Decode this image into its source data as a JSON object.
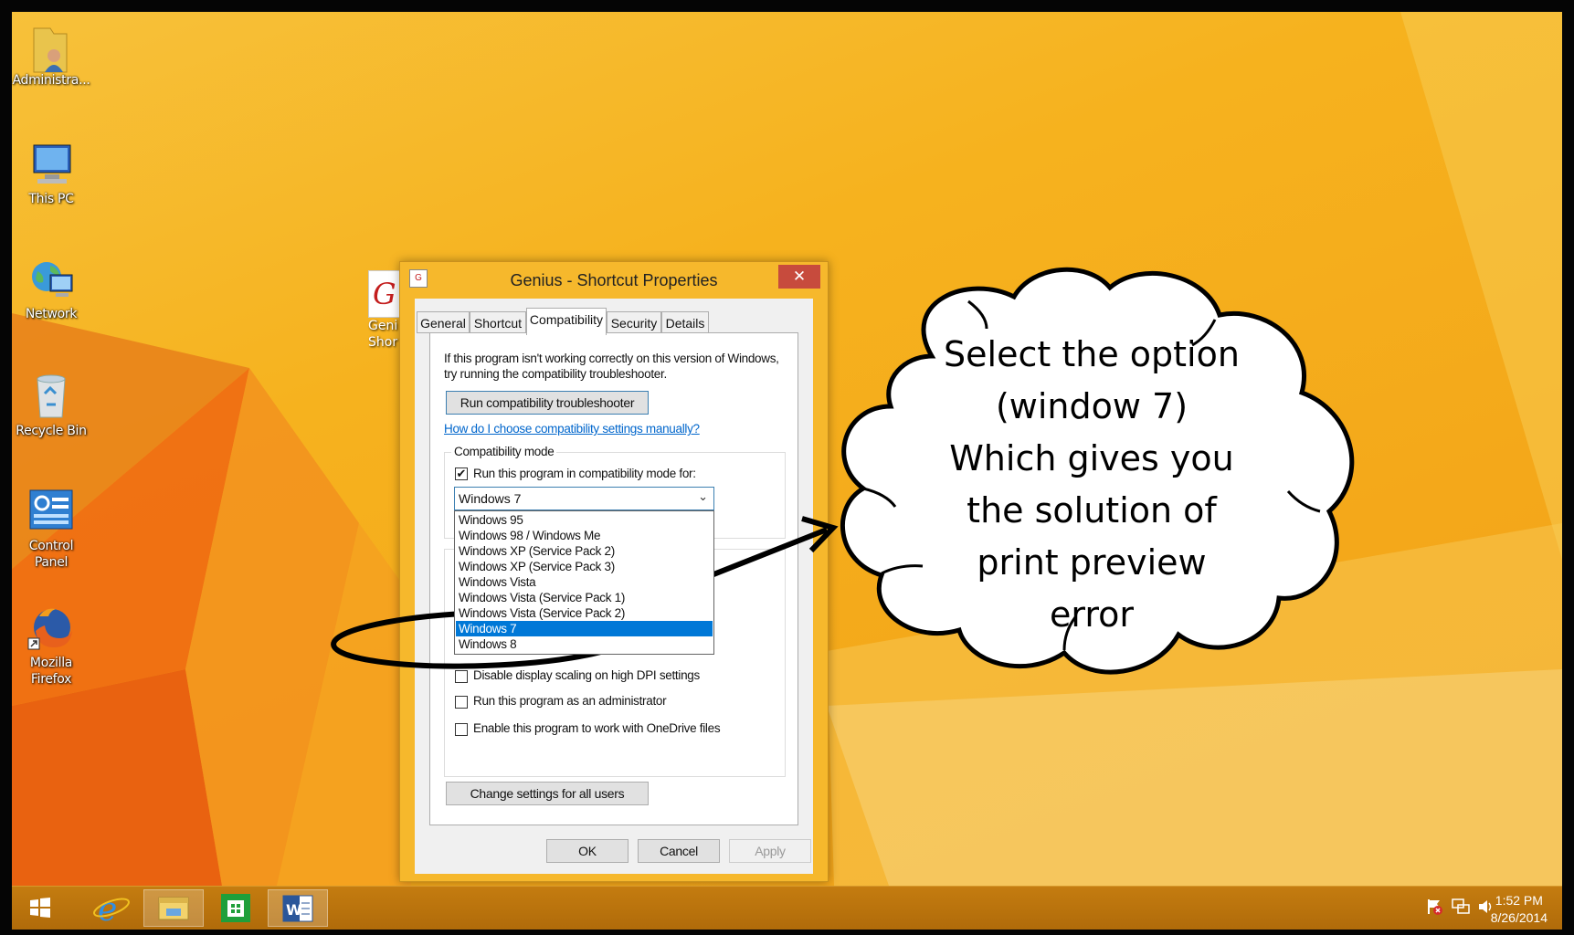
{
  "desktop_icons": [
    {
      "label": "Administra...",
      "icon": "user-folder-icon"
    },
    {
      "label": "This PC",
      "icon": "computer-icon"
    },
    {
      "label": "Network",
      "icon": "network-globe-icon"
    },
    {
      "label": "Recycle Bin",
      "icon": "recycle-bin-icon"
    },
    {
      "label": "Control Panel",
      "icon": "control-panel-icon"
    },
    {
      "label": "Mozilla Firefox",
      "icon": "firefox-icon"
    }
  ],
  "partial_icon": {
    "label_line1": "Geni",
    "label_line2": "Shor"
  },
  "dialog": {
    "title": "Genius - Shortcut Properties",
    "close_label": "✕",
    "tabs": [
      "General",
      "Shortcut",
      "Compatibility",
      "Security",
      "Details"
    ],
    "selected_tab": "Compatibility",
    "intro_line1": "If this program isn't working correctly on this version of Windows,",
    "intro_line2": "try running the compatibility troubleshooter.",
    "troubleshooter_button": "Run compatibility troubleshooter",
    "manual_link": "How do I choose compatibility settings manually?",
    "compat_group_label": "Compatibility mode",
    "compat_checkbox_label": "Run this program in compatibility mode for:",
    "compat_checked": true,
    "selected_os": "Windows 7",
    "os_options": [
      "Windows 95",
      "Windows 98 / Windows Me",
      "Windows XP (Service Pack 2)",
      "Windows XP (Service Pack 3)",
      "Windows Vista",
      "Windows Vista (Service Pack 1)",
      "Windows Vista (Service Pack 2)",
      "Windows 7",
      "Windows 8"
    ],
    "dpi_label": "Disable display scaling on high DPI settings",
    "admin_label": "Run this program as an administrator",
    "onedrive_label": "Enable this program to work with OneDrive files",
    "all_users_button": "Change settings for all users",
    "ok_button": "OK",
    "cancel_button": "Cancel",
    "apply_button": "Apply"
  },
  "callout": {
    "lines": [
      "Select the option",
      "(window 7)",
      "Which gives you",
      "the solution of",
      "print preview",
      "error"
    ]
  },
  "taskbar": {
    "items": [
      "windows-start-icon",
      "internet-explorer-icon",
      "file-explorer-icon",
      "store-icon",
      "word-icon"
    ],
    "tray_icons": [
      "action-center-flag-icon",
      "network-icon",
      "volume-icon"
    ],
    "time": "1:52 PM",
    "date": "8/26/2014"
  },
  "colors": {
    "accent": "#f6b82c",
    "selection": "#0078d7",
    "close": "#c74b3d"
  }
}
